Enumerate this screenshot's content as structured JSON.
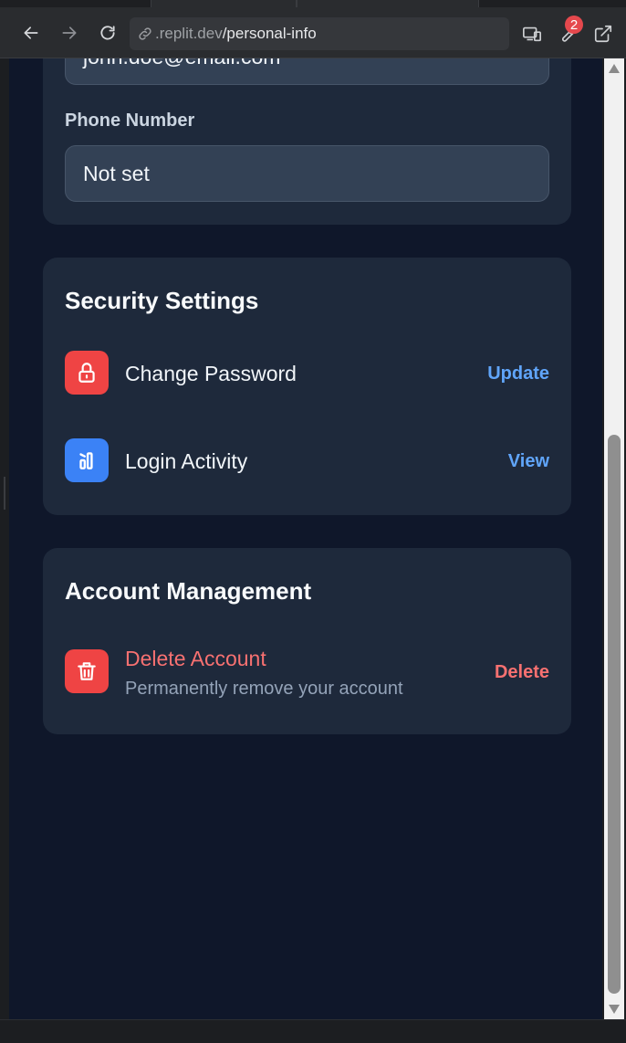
{
  "browser": {
    "url_host": ".replit.dev",
    "url_path": "/personal-info",
    "devtools_badge": "2"
  },
  "contact": {
    "email_value": "john.doe@email.com",
    "phone_label": "Phone Number",
    "phone_value": "Not set"
  },
  "security": {
    "title": "Security Settings",
    "items": [
      {
        "label": "Change Password",
        "action": "Update",
        "icon": "lock-icon",
        "icon_color": "#ef4444",
        "action_color": "#60a5fa"
      },
      {
        "label": "Login Activity",
        "action": "View",
        "icon": "activity-chart-icon",
        "icon_color": "#3b82f6",
        "action_color": "#60a5fa"
      }
    ]
  },
  "account": {
    "title": "Account Management",
    "delete_title": "Delete Account",
    "delete_subtitle": "Permanently remove your account",
    "delete_action": "Delete",
    "danger_color": "#f87171",
    "icon": "trash-icon",
    "icon_color": "#ef4444"
  }
}
